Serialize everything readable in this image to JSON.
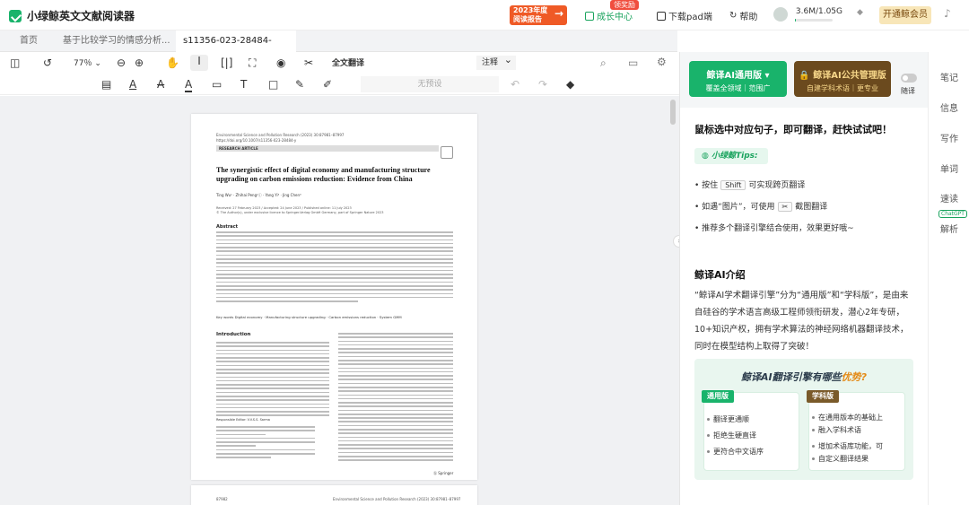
{
  "app": {
    "title": "小绿鲸英文文献阅读器"
  },
  "titlebar": {
    "report_line1": "2023年度",
    "report_line2": "阅读报告",
    "report_arrow": "→",
    "red_badge": "领奖励",
    "growth": "成长中心",
    "pad": "下载pad端",
    "help": "帮助",
    "storage": "3.6M/1.05G",
    "storage_fraction": 0.0033,
    "member": "开通鲸会员"
  },
  "tabs": [
    {
      "label": "首页",
      "close": ""
    },
    {
      "label": "基于比较学习的情感分析...",
      "close": "×"
    },
    {
      "label": "s11356-023-28484-y",
      "close": "×"
    }
  ],
  "toolbar": {
    "zoom": "77％",
    "full_translate": "全文翻译",
    "annotate": "注释",
    "preset": "无预设"
  },
  "panel": {
    "general": {
      "title": "鲸译AI通用版 ▾",
      "sub": "覆盖全领域｜范围广"
    },
    "pro": {
      "title": "🔒 鲸译AI公共管理版",
      "sub": "自建学科术语｜更专业"
    },
    "toggle_label": "随译",
    "heading": "鼠标选中对应句子，即可翻译，赶快试试吧！",
    "tips_label": "小绿鲸Tips:",
    "tip1_a": "按住",
    "tip1_key": "Shift",
    "tip1_b": "可实现跨页翻译",
    "tip2_a": "如遇“图片”，可使用",
    "tip2_b": "截图翻译",
    "tip3": "推荐多个翻译引擎结合使用，效果更好哦~",
    "intro_title": "鲸译AI介绍",
    "intro_text": "“鲸译AI学术翻译引擎”分为“通用版”和“学科版”，是由来自硅谷的学术语言高级工程师领衔研发，潜心2年专研，10+知识产权，拥有学术算法的神经网络机器翻译技术，同时在模型结构上取得了突破！",
    "banner_title_a": "鲸译AI翻译引擎有哪些",
    "banner_title_b": "优势?",
    "general_box": {
      "tag": "通用版",
      "items": [
        "翻译更通顺",
        "拒绝生硬直译",
        "更符合中文语序"
      ]
    },
    "subject_box": {
      "tag": "学科版",
      "items": [
        "在通用版本的基础上",
        "融入学科术语",
        "增加术语库功能，可",
        "自定义翻译结果"
      ]
    }
  },
  "rail": [
    "笔记",
    "信息",
    "写作",
    "单词",
    "速读",
    "解析"
  ],
  "rail_badge": "ChatGPT",
  "document": {
    "journal": "Environmental Science and Pollution Research (2023) 30:87981–87997",
    "doi": "https://doi.org/10.1007/s11356-023-28484-y",
    "tag": "RESEARCH ARTICLE",
    "title": "The synergistic effect of digital economy and manufacturing structure upgrading on carbon emissions reduction: Evidence from China",
    "authors": "Ting Wu¹ · Zhihai Peng²ⓘ · Yang Yi³ · Jing Chen³",
    "received": "Received: 27 February 2023 / Accepted: 24 June 2023 / Published online: 11 July 2023",
    "copyright": "© The Author(s), under exclusive licence to Springer-Verlag GmbH Germany, part of Springer Nature 2023",
    "abstract_h": "Abstract",
    "keywords": "Key words  Digital economy · Manufacturing structure upgrading · Carbon emissions reduction · System GMM",
    "intro_h": "Introduction",
    "editor": "Responsible Editor: V.V.S.S. Sarma",
    "footer_page": "87982",
    "springer": "Ⓢ Springer"
  }
}
